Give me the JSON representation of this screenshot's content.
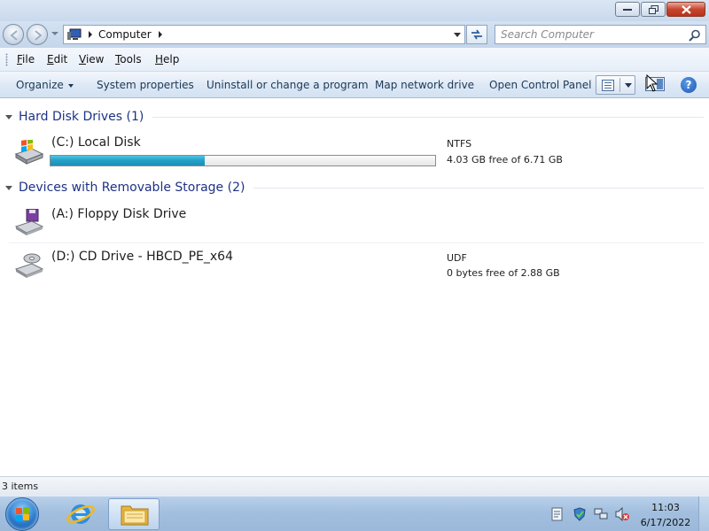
{
  "address": {
    "breadcrumb": "Computer"
  },
  "search": {
    "placeholder": "Search Computer"
  },
  "menu": {
    "items": [
      {
        "label": "File",
        "accel": "F",
        "rest": "ile"
      },
      {
        "label": "Edit",
        "accel": "E",
        "rest": "dit"
      },
      {
        "label": "View",
        "accel": "V",
        "rest": "iew"
      },
      {
        "label": "Tools",
        "accel": "T",
        "rest": "ools"
      },
      {
        "label": "Help",
        "accel": "H",
        "rest": "elp"
      }
    ]
  },
  "commands": {
    "organize": "Organize",
    "system_properties": "System properties",
    "uninstall": "Uninstall or change a program",
    "map_drive": "Map network drive",
    "control_panel": "Open Control Panel"
  },
  "groups": {
    "hard_disk": "Hard Disk Drives (1)",
    "removable": "Devices with Removable Storage (2)"
  },
  "drives": {
    "c": {
      "name": "(C:) Local Disk",
      "fs": "NTFS",
      "free": "4.03 GB free of 6.71 GB",
      "used_fraction": 0.4,
      "icon": "hard-disk-icon"
    },
    "a": {
      "name": "(A:) Floppy Disk Drive",
      "icon": "floppy-drive-icon"
    },
    "d": {
      "name": "(D:) CD Drive - HBCD_PE_x64",
      "fs": "UDF",
      "free": "0 bytes free of 2.88 GB",
      "icon": "cd-drive-icon"
    }
  },
  "status": {
    "items": "3 items"
  },
  "taskbar": {
    "time": "11:03",
    "date": "6/17/2022"
  },
  "colors": {
    "group_title": "#1e3287",
    "progress": "#26a0c9",
    "command_text": "#1d3857"
  }
}
